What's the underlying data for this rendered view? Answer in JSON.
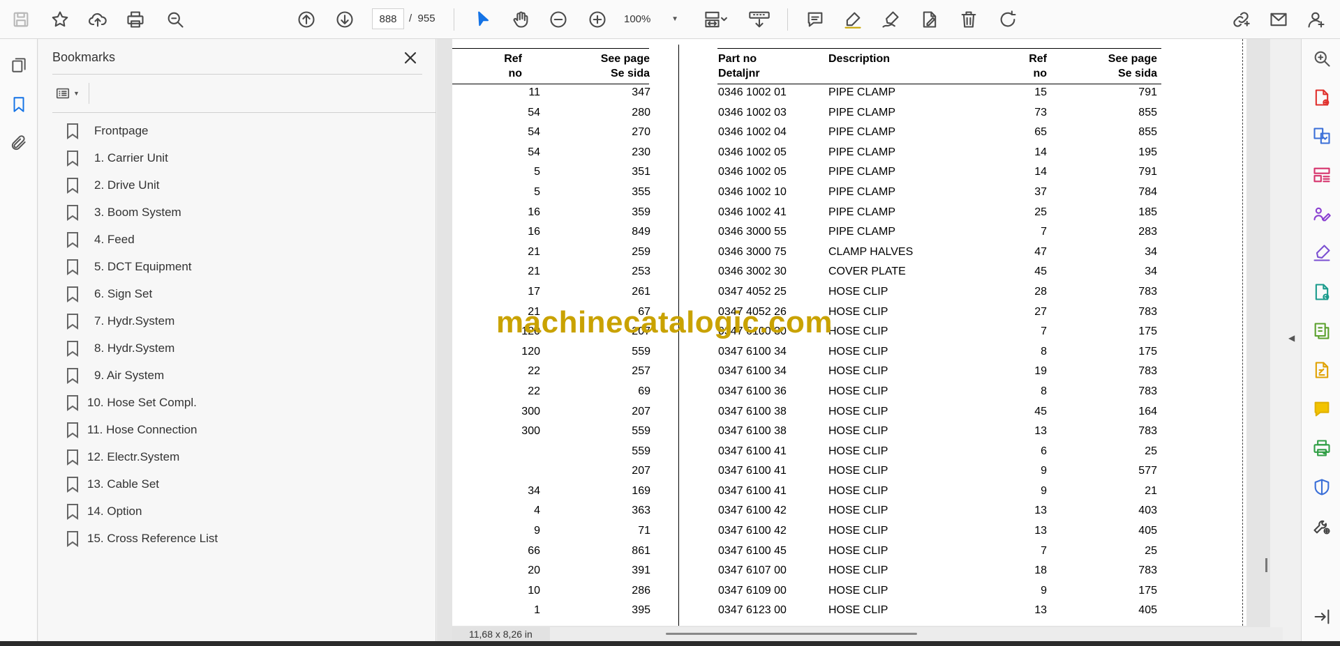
{
  "toolbar": {
    "current_page": "888",
    "page_separator": "/",
    "total_pages": "955",
    "zoom": "100%"
  },
  "bookmarks": {
    "title": "Bookmarks",
    "items": [
      {
        "label": "Frontpage"
      },
      {
        "label": "1. Carrier Unit"
      },
      {
        "label": "2. Drive Unit"
      },
      {
        "label": "3. Boom System"
      },
      {
        "label": "4. Feed"
      },
      {
        "label": "5. DCT Equipment"
      },
      {
        "label": "6. Sign Set"
      },
      {
        "label": "7. Hydr.System"
      },
      {
        "label": "8. Hydr.System"
      },
      {
        "label": "9. Air System"
      },
      {
        "label": "10. Hose Set Compl."
      },
      {
        "label": "11. Hose Connection"
      },
      {
        "label": "12. Electr.System"
      },
      {
        "label": "13. Cable Set"
      },
      {
        "label": "14. Option"
      },
      {
        "label": "15. Cross Reference List"
      }
    ]
  },
  "document": {
    "left_table": {
      "headers": {
        "ref_1": "Ref",
        "ref_2": "no",
        "page_1": "See page",
        "page_2": "Se sida"
      },
      "rows": [
        {
          "ref": "11",
          "page": "347"
        },
        {
          "ref": "54",
          "page": "280"
        },
        {
          "ref": "54",
          "page": "270"
        },
        {
          "ref": "54",
          "page": "230"
        },
        {
          "ref": "5",
          "page": "351"
        },
        {
          "ref": "5",
          "page": "355"
        },
        {
          "ref": "16",
          "page": "359"
        },
        {
          "ref": "16",
          "page": "849"
        },
        {
          "ref": "21",
          "page": "259"
        },
        {
          "ref": "21",
          "page": "253"
        },
        {
          "ref": "17",
          "page": "261"
        },
        {
          "ref": "21",
          "page": "67"
        },
        {
          "ref": "120",
          "page": "207"
        },
        {
          "ref": "120",
          "page": "559"
        },
        {
          "ref": "22",
          "page": "257"
        },
        {
          "ref": "22",
          "page": "69"
        },
        {
          "ref": "300",
          "page": "207"
        },
        {
          "ref": "300",
          "page": "559"
        },
        {
          "ref": "",
          "page": "559"
        },
        {
          "ref": "",
          "page": "207"
        },
        {
          "ref": "34",
          "page": "169"
        },
        {
          "ref": "4",
          "page": "363"
        },
        {
          "ref": "9",
          "page": "71"
        },
        {
          "ref": "66",
          "page": "861"
        },
        {
          "ref": "20",
          "page": "391"
        },
        {
          "ref": "10",
          "page": "286"
        },
        {
          "ref": "1",
          "page": "395"
        }
      ]
    },
    "right_table": {
      "headers": {
        "part_1": "Part no",
        "part_2": "Detaljnr",
        "desc": "Description",
        "ref_1": "Ref",
        "ref_2": "no",
        "page_1": "See page",
        "page_2": "Se sida"
      },
      "rows": [
        {
          "part": "0346 1002 01",
          "desc": "PIPE CLAMP",
          "ref": "15",
          "page": "791"
        },
        {
          "part": "0346 1002 03",
          "desc": "PIPE CLAMP",
          "ref": "73",
          "page": "855"
        },
        {
          "part": "0346 1002 04",
          "desc": "PIPE CLAMP",
          "ref": "65",
          "page": "855"
        },
        {
          "part": "0346 1002 05",
          "desc": "PIPE CLAMP",
          "ref": "14",
          "page": "195"
        },
        {
          "part": "0346 1002 05",
          "desc": "PIPE CLAMP",
          "ref": "14",
          "page": "791"
        },
        {
          "part": "0346 1002 10",
          "desc": "PIPE CLAMP",
          "ref": "37",
          "page": "784"
        },
        {
          "part": "0346 1002 41",
          "desc": "PIPE CLAMP",
          "ref": "25",
          "page": "185"
        },
        {
          "part": "0346 3000 55",
          "desc": "PIPE CLAMP",
          "ref": "7",
          "page": "283"
        },
        {
          "part": "0346 3000 75",
          "desc": "CLAMP HALVES",
          "ref": "47",
          "page": "34"
        },
        {
          "part": "0346 3002 30",
          "desc": "COVER PLATE",
          "ref": "45",
          "page": "34"
        },
        {
          "part": "0347 4052 25",
          "desc": "HOSE CLIP",
          "ref": "28",
          "page": "783"
        },
        {
          "part": "0347 4052 26",
          "desc": "HOSE CLIP",
          "ref": "27",
          "page": "783"
        },
        {
          "part": "0347 6100 30",
          "desc": "HOSE CLIP",
          "ref": "7",
          "page": "175"
        },
        {
          "part": "0347 6100 34",
          "desc": "HOSE CLIP",
          "ref": "8",
          "page": "175"
        },
        {
          "part": "0347 6100 34",
          "desc": "HOSE CLIP",
          "ref": "19",
          "page": "783"
        },
        {
          "part": "0347 6100 36",
          "desc": "HOSE CLIP",
          "ref": "8",
          "page": "783"
        },
        {
          "part": "0347 6100 38",
          "desc": "HOSE CLIP",
          "ref": "45",
          "page": "164"
        },
        {
          "part": "0347 6100 38",
          "desc": "HOSE CLIP",
          "ref": "13",
          "page": "783"
        },
        {
          "part": "0347 6100 41",
          "desc": "HOSE CLIP",
          "ref": "6",
          "page": "25"
        },
        {
          "part": "0347 6100 41",
          "desc": "HOSE CLIP",
          "ref": "9",
          "page": "577"
        },
        {
          "part": "0347 6100 41",
          "desc": "HOSE CLIP",
          "ref": "9",
          "page": "21"
        },
        {
          "part": "0347 6100 42",
          "desc": "HOSE CLIP",
          "ref": "13",
          "page": "403"
        },
        {
          "part": "0347 6100 42",
          "desc": "HOSE CLIP",
          "ref": "13",
          "page": "405"
        },
        {
          "part": "0347 6100 45",
          "desc": "HOSE CLIP",
          "ref": "7",
          "page": "25"
        },
        {
          "part": "0347 6107 00",
          "desc": "HOSE CLIP",
          "ref": "18",
          "page": "783"
        },
        {
          "part": "0347 6109 00",
          "desc": "HOSE CLIP",
          "ref": "9",
          "page": "175"
        },
        {
          "part": "0347 6123 00",
          "desc": "HOSE CLIP",
          "ref": "13",
          "page": "405"
        }
      ]
    },
    "watermark": "machinecatalogic.com"
  },
  "status": {
    "page_size": "11,68 x 8,26 in"
  },
  "icons": {
    "toolbar": [
      "save-icon",
      "bookmark-star-icon",
      "upload-icon",
      "print-icon",
      "find-icon",
      "page-up-icon",
      "page-down-icon",
      "select-tool-icon",
      "hand-tool-icon",
      "zoom-out-icon",
      "zoom-in-icon",
      "fit-page-icon",
      "scroll-mode-icon",
      "comment-icon",
      "highlight-icon",
      "sign-icon",
      "fill-sign-icon",
      "delete-icon",
      "rotate-icon",
      "share-link-icon",
      "email-icon",
      "account-icon"
    ],
    "right_rail": [
      "search-zoom-icon",
      "create-pdf-icon",
      "export-pdf-icon",
      "organize-pages-icon",
      "request-signatures-icon",
      "fill-and-sign-icon",
      "export-icon",
      "compress-icon",
      "edit-pdf-icon",
      "comment-icon",
      "scan-icon",
      "protect-icon",
      "more-tools-icon",
      "expand-panel-icon"
    ]
  },
  "colors": {
    "accent": "#1473e6",
    "watermark": "#c9a200"
  }
}
